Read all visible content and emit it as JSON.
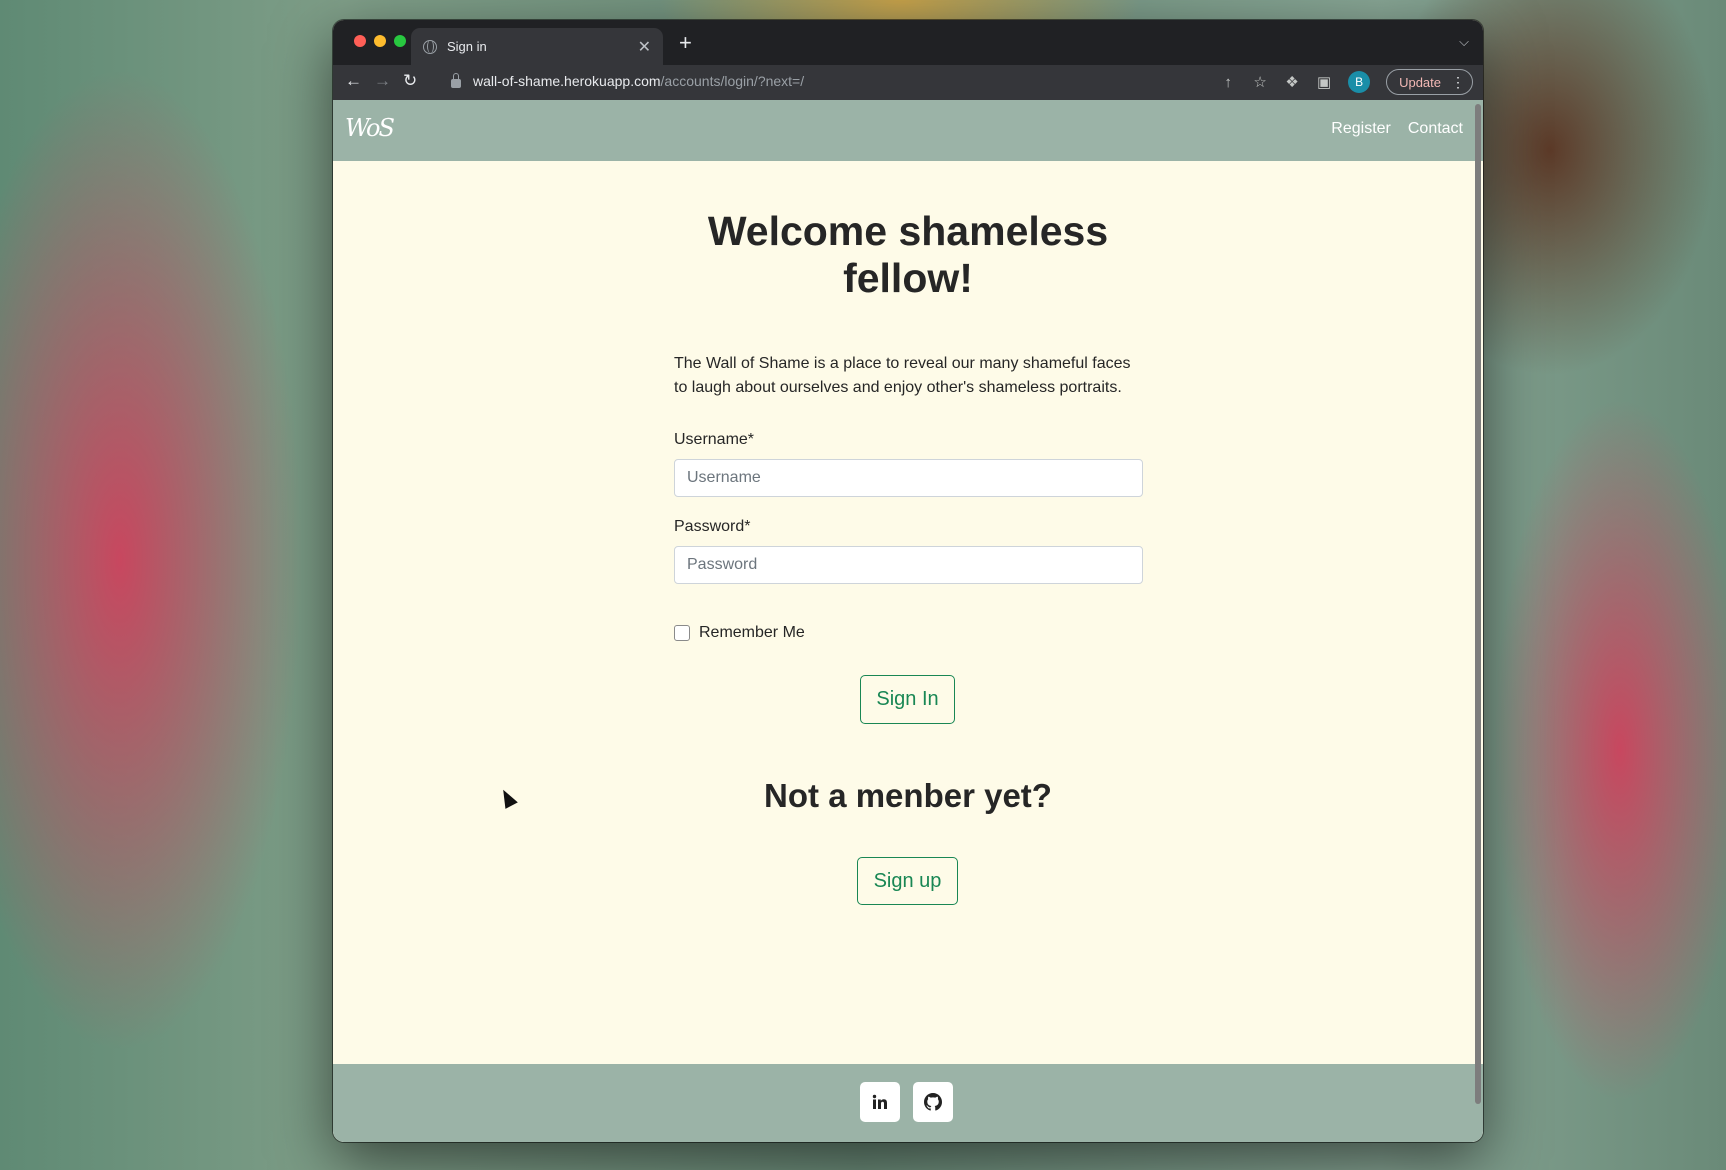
{
  "browser": {
    "tab_title": "Sign in",
    "tab_close": "✕",
    "new_tab": "+",
    "url_host": "wall-of-shame.herokuapp.com",
    "url_path": "/accounts/login/?next=/",
    "avatar_letter": "B",
    "update_label": "Update"
  },
  "site": {
    "logo": "WoS",
    "nav": {
      "register": "Register",
      "contact": "Contact"
    }
  },
  "login": {
    "title_line1": "Welcome shameless",
    "title_line2": "fellow!",
    "intro": "The Wall of Shame is a place to reveal our many shameful faces to laugh about ourselves and enjoy other's shameless portraits.",
    "username_label": "Username*",
    "username_placeholder": "Username",
    "password_label": "Password*",
    "password_placeholder": "Password",
    "remember_label": "Remember Me",
    "sign_in": "Sign In",
    "not_member": "Not a menber yet?",
    "sign_up": "Sign up"
  },
  "footer": {
    "icons": [
      "linkedin-icon",
      "github-icon"
    ]
  },
  "colors": {
    "accent": "#198754",
    "navbar": "#9bb3a7",
    "page_bg": "#fefbe8"
  }
}
